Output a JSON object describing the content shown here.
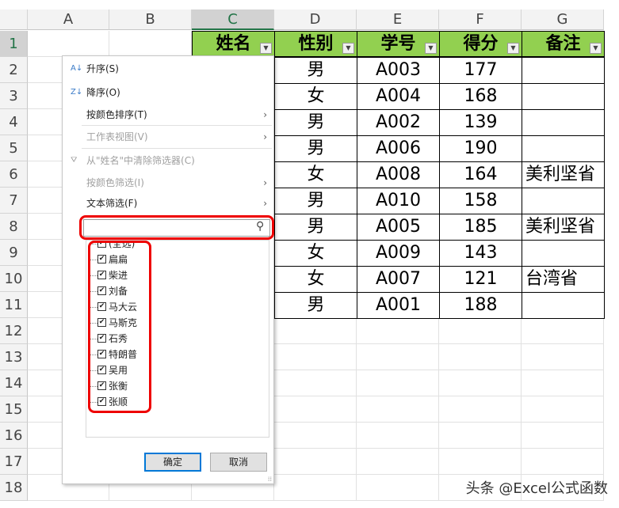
{
  "columns": [
    "A",
    "B",
    "C",
    "D",
    "E",
    "F",
    "G"
  ],
  "rows": [
    "1",
    "2",
    "3",
    "4",
    "5",
    "6",
    "7",
    "8",
    "9",
    "10",
    "11",
    "12",
    "13",
    "14",
    "15",
    "16",
    "17",
    "18"
  ],
  "headers": [
    "姓名",
    "性别",
    "学号",
    "得分",
    "备注"
  ],
  "data": [
    [
      "男",
      "A003",
      "177",
      ""
    ],
    [
      "女",
      "A004",
      "168",
      ""
    ],
    [
      "男",
      "A002",
      "139",
      ""
    ],
    [
      "男",
      "A006",
      "190",
      ""
    ],
    [
      "女",
      "A008",
      "164",
      "美利坚省"
    ],
    [
      "男",
      "A010",
      "158",
      ""
    ],
    [
      "男",
      "A005",
      "185",
      "美利坚省"
    ],
    [
      "女",
      "A009",
      "143",
      ""
    ],
    [
      "女",
      "A007",
      "121",
      "台湾省"
    ],
    [
      "男",
      "A001",
      "188",
      ""
    ]
  ],
  "menu": {
    "sort_asc": "升序(S)",
    "sort_desc": "降序(O)",
    "sort_color": "按颜色排序(T)",
    "sheet_view": "工作表视图(V)",
    "clear_filter": "从\"姓名\"中清除筛选器(C)",
    "filter_color": "按颜色筛选(I)",
    "text_filter": "文本筛选(F)",
    "search_value": "",
    "items": [
      "(全选)",
      "扁扁",
      "柴进",
      "刘备",
      "马大云",
      "马斯克",
      "石秀",
      "特朗普",
      "吴用",
      "张衡",
      "张顺"
    ],
    "ok": "确定",
    "cancel": "取消"
  },
  "watermark": "头条 @Excel公式函数",
  "colors": {
    "header_green": "#92d050",
    "highlight_red": "#e00000"
  }
}
